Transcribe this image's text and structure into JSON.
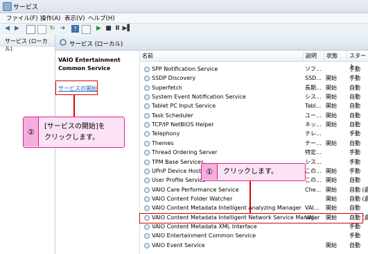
{
  "window": {
    "title": "サービス"
  },
  "menu": [
    "ファイル(F)",
    "操作(A)",
    "表示(V)",
    "ヘルプ(H)"
  ],
  "tree": {
    "root_label": "サービス (ローカル)"
  },
  "main": {
    "header": "サービス (ローカル)",
    "selected_service_name": "VAIO Entertainment Common Service",
    "start_link": "サービスの開始"
  },
  "columns": [
    "名前",
    "説明",
    "状態",
    "スタート"
  ],
  "services": [
    {
      "name": "SPP Notification Service",
      "desc": "ソフ...",
      "status": "",
      "startup": "手動"
    },
    {
      "name": "SSDP Discovery",
      "desc": "SSD...",
      "status": "開始",
      "startup": "手動"
    },
    {
      "name": "Superfetch",
      "desc": "長期...",
      "status": "開始",
      "startup": "自動"
    },
    {
      "name": "System Event Notification Service",
      "desc": "シス...",
      "status": "開始",
      "startup": "自動"
    },
    {
      "name": "Tablet PC Input Service",
      "desc": "Tabl...",
      "status": "開始",
      "startup": "自動"
    },
    {
      "name": "Task Scheduler",
      "desc": "ユー...",
      "status": "開始",
      "startup": "自動"
    },
    {
      "name": "TCP/IP NetBIOS Helper",
      "desc": "ネッ...",
      "status": "開始",
      "startup": "自動"
    },
    {
      "name": "Telephony",
      "desc": "テレ...",
      "status": "",
      "startup": "手動"
    },
    {
      "name": "Themes",
      "desc": "テー...",
      "status": "開始",
      "startup": "自動"
    },
    {
      "name": "Thread Ordering Server",
      "desc": "特定...",
      "status": "",
      "startup": "手動"
    },
    {
      "name": "TPM Base Services",
      "desc": "シス...",
      "status": "",
      "startup": "手動"
    },
    {
      "name": "UPnP Device Host",
      "desc": "この...",
      "status": "開始",
      "startup": "手動"
    },
    {
      "name": "User Profile Service",
      "desc": "この...",
      "status": "開始",
      "startup": "自動"
    },
    {
      "name": "VAIO Care Performance Service",
      "desc": "Che...",
      "status": "開始",
      "startup": "自動 (遅延"
    },
    {
      "name": "VAIO Content Folder Watcher",
      "desc": "",
      "status": "開始",
      "startup": "自動 (遅延"
    },
    {
      "name": "VAIO Content Metadata Intelligent Analyzing Manager",
      "desc": "VAI...",
      "status": "開始",
      "startup": "自動"
    },
    {
      "name": "VAIO Content Metadata Intelligent Network Service Manager",
      "desc": "VAI...",
      "status": "開始",
      "startup": "自動 (遅延"
    },
    {
      "name": "VAIO Content Metadata XML Interface",
      "desc": "",
      "status": "",
      "startup": "手動"
    },
    {
      "name": "VAIO Entertainment Common Service",
      "desc": "",
      "status": "",
      "startup": "手動"
    },
    {
      "name": "VAIO Event Service",
      "desc": "",
      "status": "開始",
      "startup": "自動"
    }
  ],
  "callouts": {
    "step1": {
      "num": "①",
      "text": "クリックします。"
    },
    "step2": {
      "num": "②",
      "line1": "[サービスの開始]を",
      "line2": "クリックします。"
    }
  },
  "colors": {
    "accent": "#e0208a",
    "callout_bg": "#fbe3f5",
    "highlight": "#e00000",
    "link": "#1f5fb5"
  }
}
